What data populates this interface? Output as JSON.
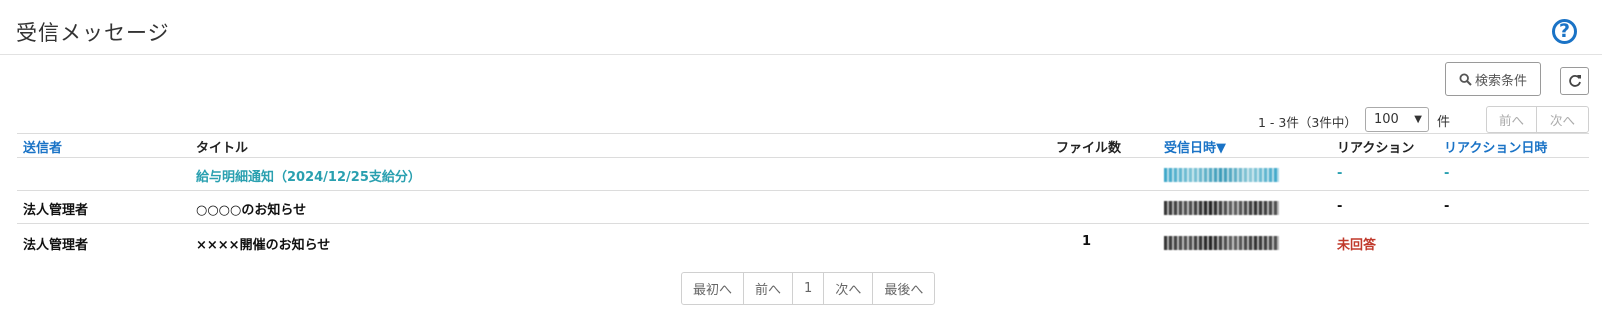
{
  "header": {
    "title": "受信メッセージ",
    "help_icon_text": "?"
  },
  "toolbar": {
    "search_label": "検索条件",
    "refresh_icon": "refresh-icon"
  },
  "paging_top": {
    "range_text": "1 - 3件（3件中）",
    "per_page": "100",
    "unit": "件",
    "prev": "前へ",
    "next": "次へ"
  },
  "table": {
    "columns": {
      "sender": "送信者",
      "title": "タイトル",
      "files": "ファイル数",
      "received": "受信日時▼",
      "reaction": "リアクション",
      "reaction_date": "リアクション日時"
    },
    "rows": [
      {
        "sender": "",
        "title": "給与明細通知（2024/12/25支給分）",
        "files": "",
        "reaction": "-",
        "reaction_date": "-"
      },
      {
        "sender": "法人管理者",
        "title": "○○○○のお知らせ",
        "files": "",
        "reaction": "-",
        "reaction_date": "-"
      },
      {
        "sender": "法人管理者",
        "title": "××××開催のお知らせ",
        "files": "1",
        "reaction": "未回答",
        "reaction_date": ""
      }
    ]
  },
  "pagination": {
    "first": "最初へ",
    "prev": "前へ",
    "current": "1",
    "next": "次へ",
    "last": "最後へ"
  },
  "colors": {
    "link_blue": "#1a73c6",
    "teal_link": "#2aa0b0",
    "unanswered_red": "#c0392b"
  }
}
